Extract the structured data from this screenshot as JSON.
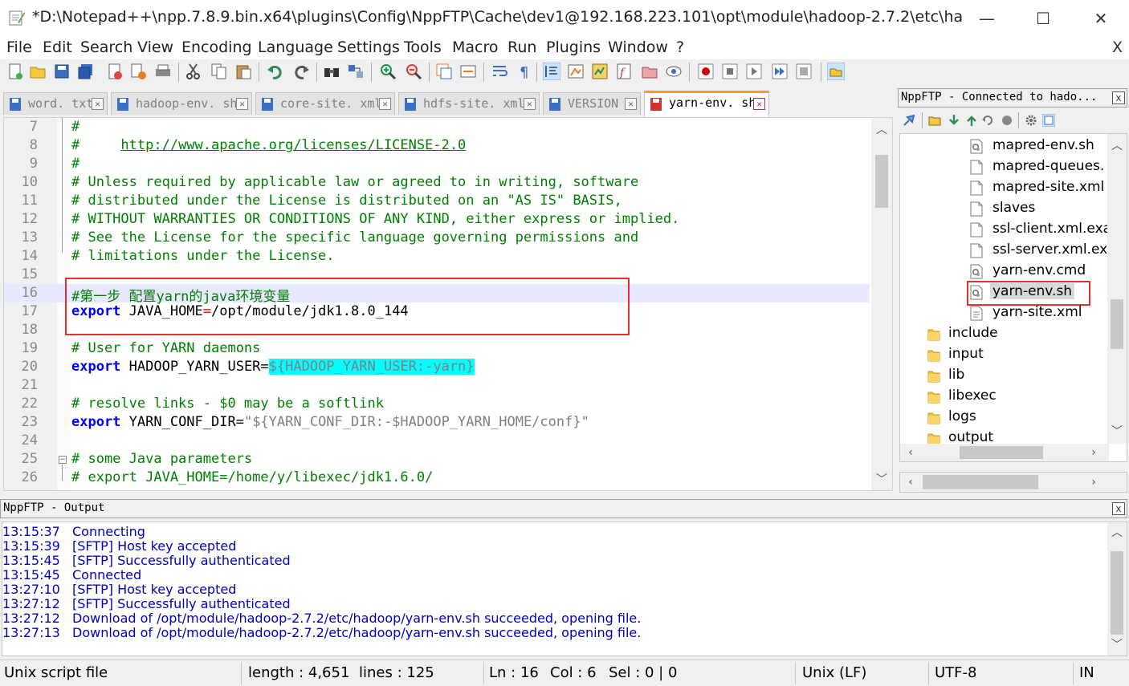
{
  "window": {
    "title": "*D:\\Notepad++\\npp.7.8.9.bin.x64\\plugins\\Config\\NppFTP\\Cache\\dev1@192.168.223.101\\opt\\module\\hadoop-2.7.2\\etc\\hadoop\\ya...",
    "minimize_glyph": "—",
    "maximize_glyph": "☐",
    "close_glyph": "✕"
  },
  "menu": {
    "items": [
      "File",
      "Edit",
      "Search",
      "View",
      "Encoding",
      "Language",
      "Settings",
      "Tools",
      "Macro",
      "Run",
      "Plugins",
      "Window",
      "?"
    ],
    "close_glyph": "X"
  },
  "tabs": [
    {
      "label": "word. txt",
      "active": false
    },
    {
      "label": "hadoop-env. sh",
      "active": false
    },
    {
      "label": "core-site. xml",
      "active": false
    },
    {
      "label": "hdfs-site. xml",
      "active": false
    },
    {
      "label": "VERSION",
      "active": false
    },
    {
      "label": "yarn-env. sh",
      "active": true
    }
  ],
  "editor": {
    "current_line": 16,
    "lines": [
      {
        "n": "7",
        "segs": [
          [
            "c-com",
            "#"
          ]
        ]
      },
      {
        "n": "8",
        "segs": [
          [
            "c-com",
            "#     "
          ],
          [
            "c-link",
            "http://www.apache.org/licenses/LICENSE-2.0"
          ]
        ]
      },
      {
        "n": "9",
        "segs": [
          [
            "c-com",
            "#"
          ]
        ]
      },
      {
        "n": "10",
        "segs": [
          [
            "c-com",
            "# Unless required by applicable law or agreed to in writing, software"
          ]
        ]
      },
      {
        "n": "11",
        "segs": [
          [
            "c-com",
            "# distributed under the License is distributed on an \"AS IS\" BASIS,"
          ]
        ]
      },
      {
        "n": "12",
        "segs": [
          [
            "c-com",
            "# WITHOUT WARRANTIES OR CONDITIONS OF ANY KIND, either express or implied."
          ]
        ]
      },
      {
        "n": "13",
        "segs": [
          [
            "c-com",
            "# See the License for the specific language governing permissions and"
          ]
        ]
      },
      {
        "n": "14",
        "segs": [
          [
            "c-com",
            "# limitations under the License."
          ]
        ]
      },
      {
        "n": "15",
        "segs": []
      },
      {
        "n": "16",
        "segs": [
          [
            "c-com",
            "#第一步 配置yarn的java环境变量"
          ]
        ]
      },
      {
        "n": "17",
        "segs": [
          [
            "c-kw",
            "export"
          ],
          [
            "c-txt",
            " JAVA_HOME"
          ],
          [
            "c-red",
            "="
          ],
          [
            "c-txt",
            "/opt/module/jdk1.8.0_144"
          ]
        ]
      },
      {
        "n": "18",
        "segs": []
      },
      {
        "n": "19",
        "segs": [
          [
            "c-com",
            "# User for YARN daemons"
          ]
        ]
      },
      {
        "n": "20",
        "segs": [
          [
            "c-kw",
            "export"
          ],
          [
            "c-txt",
            " HADOOP_YARN_USER="
          ],
          [
            "c-hl",
            "${HADOOP_YARN_USER:-yarn}"
          ]
        ]
      },
      {
        "n": "21",
        "segs": []
      },
      {
        "n": "22",
        "segs": [
          [
            "c-com",
            "# resolve links - $0 may be a softlink"
          ]
        ]
      },
      {
        "n": "23",
        "segs": [
          [
            "c-kw",
            "export"
          ],
          [
            "c-txt",
            " YARN_CONF_DIR="
          ],
          [
            "c-str",
            "\"${YARN_CONF_DIR:-$HADOOP_YARN_HOME/conf}\""
          ]
        ]
      },
      {
        "n": "24",
        "segs": []
      },
      {
        "n": "25",
        "segs": [
          [
            "c-com",
            "# some Java parameters"
          ]
        ]
      },
      {
        "n": "26",
        "segs": [
          [
            "c-com",
            "# export JAVA_HOME=/home/y/libexec/jdk1.6.0/"
          ]
        ]
      }
    ]
  },
  "ftp": {
    "header": "NppFTP - Connected to hado...",
    "close_glyph": "x",
    "tree": [
      {
        "label": "mapred-env.sh",
        "kind": "script",
        "depth": 2,
        "selected": false
      },
      {
        "label": "mapred-queues.",
        "kind": "file",
        "depth": 2,
        "selected": false
      },
      {
        "label": "mapred-site.xml",
        "kind": "file",
        "depth": 2,
        "selected": false
      },
      {
        "label": "slaves",
        "kind": "file",
        "depth": 2,
        "selected": false
      },
      {
        "label": "ssl-client.xml.exa",
        "kind": "file",
        "depth": 2,
        "selected": false
      },
      {
        "label": "ssl-server.xml.exa",
        "kind": "file",
        "depth": 2,
        "selected": false
      },
      {
        "label": "yarn-env.cmd",
        "kind": "script",
        "depth": 2,
        "selected": false
      },
      {
        "label": "yarn-env.sh",
        "kind": "script",
        "depth": 2,
        "selected": true
      },
      {
        "label": "yarn-site.xml",
        "kind": "xml",
        "depth": 2,
        "selected": false
      },
      {
        "label": "include",
        "kind": "folder",
        "depth": 1,
        "selected": false
      },
      {
        "label": "input",
        "kind": "folder",
        "depth": 1,
        "selected": false
      },
      {
        "label": "lib",
        "kind": "folder",
        "depth": 1,
        "selected": false
      },
      {
        "label": "libexec",
        "kind": "folder",
        "depth": 1,
        "selected": false
      },
      {
        "label": "logs",
        "kind": "folder",
        "depth": 1,
        "selected": false
      },
      {
        "label": "output",
        "kind": "folder",
        "depth": 1,
        "selected": false
      }
    ]
  },
  "output": {
    "header": "NppFTP - Output",
    "close_glyph": "x",
    "lines": [
      {
        "ts": "13:15:37",
        "msg": "Connecting"
      },
      {
        "ts": "13:15:39",
        "msg": "[SFTP] Host key accepted"
      },
      {
        "ts": "13:15:45",
        "msg": "[SFTP] Successfully authenticated"
      },
      {
        "ts": "13:15:45",
        "msg": "Connected"
      },
      {
        "ts": "13:27:10",
        "msg": "[SFTP] Host key accepted"
      },
      {
        "ts": "13:27:12",
        "msg": "[SFTP] Successfully authenticated"
      },
      {
        "ts": "13:27:12",
        "msg": "Download of /opt/module/hadoop-2.7.2/etc/hadoop/yarn-env.sh succeeded, opening file."
      },
      {
        "ts": "13:27:13",
        "msg": "Download of /opt/module/hadoop-2.7.2/etc/hadoop/yarn-env.sh succeeded, opening file."
      }
    ]
  },
  "status": {
    "filetype": "Unix script file",
    "length": "length : 4,651",
    "lines": "lines : 125",
    "ln": "Ln : 16",
    "col": "Col : 6",
    "sel": "Sel : 0 | 0",
    "eol": "Unix (LF)",
    "encoding": "UTF-8",
    "mode": "IN"
  },
  "scroll_glyphs": {
    "up": "︿",
    "down": "﹀",
    "left": "‹",
    "right": "›"
  },
  "colors": {
    "accent": "#fa9b28",
    "annotation_red": "#e03030",
    "log_blue": "#0000c0"
  }
}
